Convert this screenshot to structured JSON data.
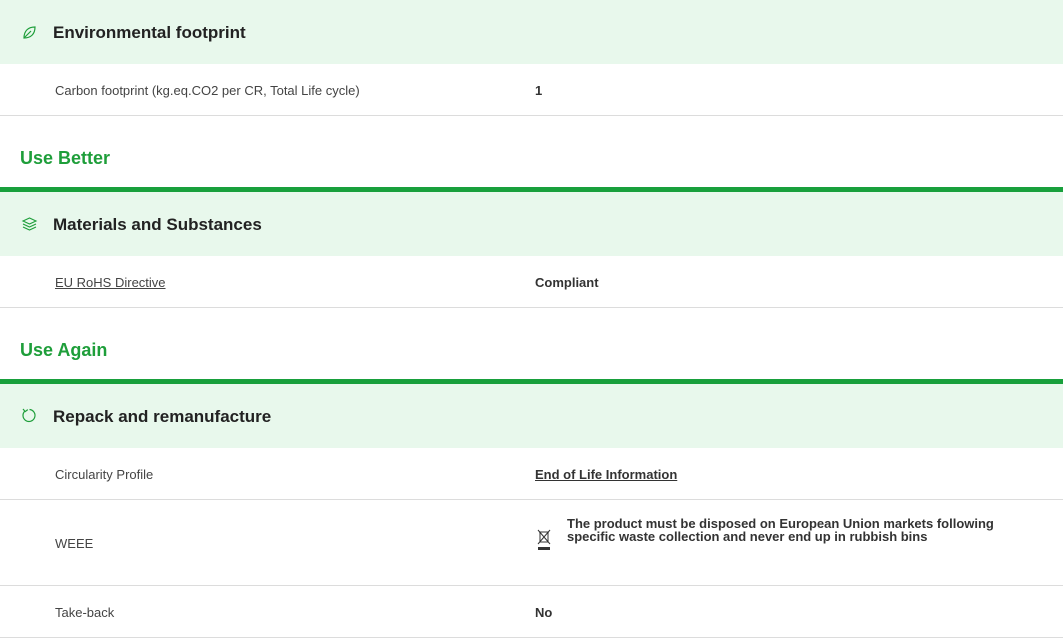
{
  "sections": {
    "environmental": {
      "icon": "leaf-icon",
      "title": "Environmental footprint",
      "rows": [
        {
          "label": "Carbon footprint (kg.eq.CO2 per CR, Total Life cycle)",
          "value": "1"
        }
      ]
    },
    "use_better": {
      "category": "Use Better",
      "icon": "layers-icon",
      "title": "Materials and Substances",
      "rows": [
        {
          "label": "EU RoHS Directive",
          "value": "Compliant"
        }
      ]
    },
    "use_again": {
      "category": "Use Again",
      "icon": "refresh-icon",
      "title": "Repack and remanufacture",
      "rows": [
        {
          "label": "Circularity Profile",
          "value": "End of Life Information"
        },
        {
          "label": "WEEE",
          "value": "The product must be disposed on European Union markets following specific waste collection and never end up in rubbish bins"
        },
        {
          "label": "Take-back",
          "value": "No"
        }
      ]
    }
  },
  "colors": {
    "accent_green": "#1e9e3a",
    "rule_green": "#18a03c",
    "header_bg": "#e8f8ec",
    "link_blue": "#1a73b8"
  }
}
